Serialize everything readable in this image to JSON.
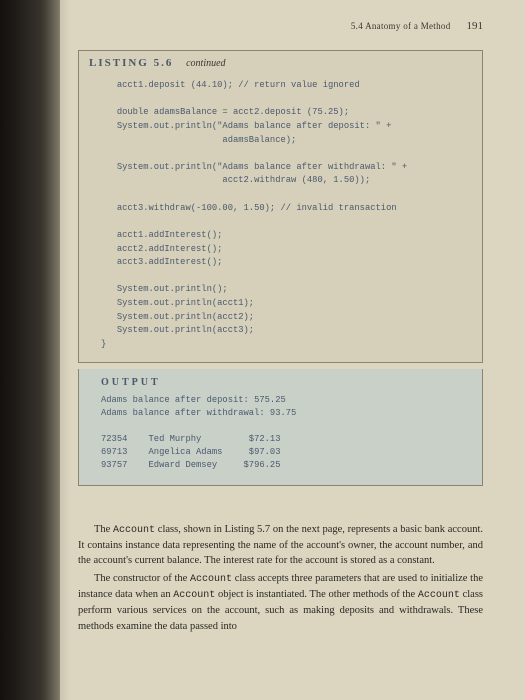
{
  "header": {
    "section": "5.4  Anatomy of a Method",
    "pagenum": "191"
  },
  "listing": {
    "number": "LISTING 5.6",
    "continued": "continued",
    "code": "   acct1.deposit (44.10); // return value ignored\n\n   double adamsBalance = acct2.deposit (75.25);\n   System.out.println(\"Adams balance after deposit: \" +\n                       adamsBalance);\n\n   System.out.println(\"Adams balance after withdrawal: \" +\n                       acct2.withdraw (480, 1.50));\n\n   acct3.withdraw(-100.00, 1.50); // invalid transaction\n\n   acct1.addInterest();\n   acct2.addInterest();\n   acct3.addInterest();\n\n   System.out.println();\n   System.out.println(acct1);\n   System.out.println(acct2);\n   System.out.println(acct3);\n}"
  },
  "output": {
    "label": "OUTPUT",
    "text": "Adams balance after deposit: 575.25\nAdams balance after withdrawal: 93.75\n\n72354    Ted Murphy         $72.13\n69713    Angelica Adams     $97.03\n93757    Edward Demsey     $796.25"
  },
  "paragraphs": {
    "p1a": "The ",
    "p1b": " class, shown in Listing 5.7 on the next page, represents a basic bank account. It contains instance data representing the name of the account's owner, the account number, and the account's current balance. The interest rate for the account is stored as a constant.",
    "p2a": "The constructor of the ",
    "p2b": " class accepts three parameters that are used to initialize the instance data when an ",
    "p2c": " object is instantiated. The other methods of the ",
    "p2d": " class perform various services on the account, such as making deposits and withdrawals. These methods examine the data passed into",
    "account": "Account"
  }
}
